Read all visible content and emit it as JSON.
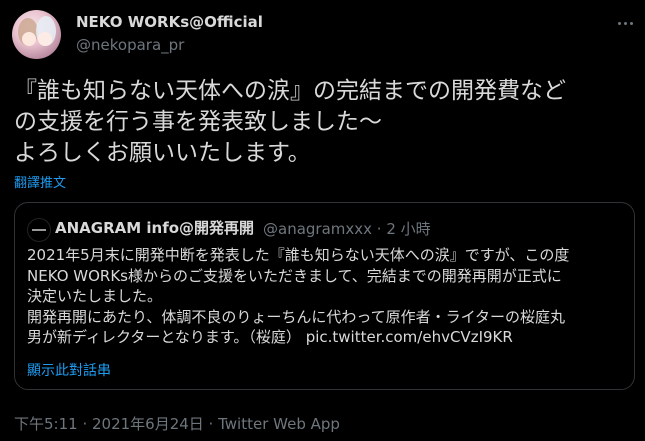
{
  "author": {
    "name": "NEKO WORKs@Official",
    "handle": "@nekopara_pr"
  },
  "tweet": {
    "text": "『誰も知らない天体への涙』の完結までの開発費など\nの支援を行う事を発表致しました〜\nよろしくお願いいたします。",
    "translate_label": "翻譯推文"
  },
  "quoted": {
    "name": "ANAGRAM info@開発再開",
    "handle": "@anagramxxx",
    "separator": "·",
    "time": "2 小時",
    "text": "2021年5月末に開発中断を発表した『誰も知らない天体への涙』ですが、この度\nNEKO WORKs様からのご支援をいただきまして、完結までの開発再開が正式に\n決定いたしました。\n開発再開にあたり、体調不良のりょーちんに代わって原作者・ライターの桜庭丸\n男が新ディレクターとなります。（桜庭）",
    "link": "pic.twitter.com/ehvCVzI9KR",
    "show_thread": "顯示此對話串"
  },
  "timestamp": "下午5:11 · 2021年6月24日 · Twitter Web App",
  "icons": {
    "more": "more-horizontal-icon"
  },
  "colors": {
    "background": "#000000",
    "text": "#d9d9d9",
    "muted": "#6e767d",
    "accent": "#1d9bf0",
    "border": "#2f3336"
  }
}
